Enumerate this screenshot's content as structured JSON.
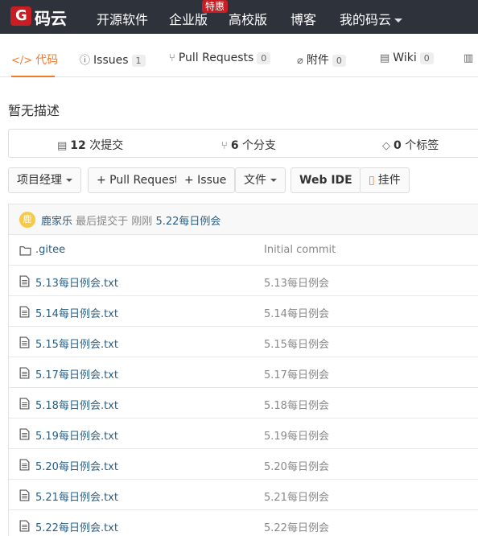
{
  "topnav": {
    "brand": "码云",
    "logo_letter": "G",
    "links": [
      "开源软件",
      "企业版",
      "高校版",
      "博客",
      "我的码云"
    ],
    "special_badge": "特惠"
  },
  "tabs": [
    {
      "label": "代码",
      "icon": "code-icon",
      "count": null
    },
    {
      "label": "Issues",
      "icon": "issues-icon",
      "count": "1"
    },
    {
      "label": "Pull Requests",
      "icon": "pull-request-icon",
      "count": "0"
    },
    {
      "label": "附件",
      "icon": "attachment-icon",
      "count": "0"
    },
    {
      "label": "Wiki",
      "icon": "wiki-icon",
      "count": "0"
    }
  ],
  "description": "暂无描述",
  "stats": {
    "commits_count": "12",
    "commits_label": "次提交",
    "branches_count": "6",
    "branches_label": "个分支",
    "tags_count": "0",
    "tags_label": "个标签"
  },
  "actions": {
    "manage": "项目经理",
    "pull_request": "+ Pull Request",
    "issue": "+ Issue",
    "file": "文件",
    "webide": "Web IDE",
    "attach": "挂件"
  },
  "commit": {
    "avatar_text": "鹿",
    "author": "鹿家乐",
    "text": "最后提交于 刚刚",
    "message": "5.22每日例会"
  },
  "files": [
    {
      "name": ".gitee",
      "type": "folder",
      "message": "Initial commit"
    },
    {
      "name": "5.13每日例会.txt",
      "type": "file",
      "message": "5.13每日例会"
    },
    {
      "name": "5.14每日例会.txt",
      "type": "file",
      "message": "5.14每日例会"
    },
    {
      "name": "5.15每日例会.txt",
      "type": "file",
      "message": "5.15每日例会"
    },
    {
      "name": "5.17每日例会.txt",
      "type": "file",
      "message": "5.17每日例会"
    },
    {
      "name": "5.18每日例会.txt",
      "type": "file",
      "message": "5.18每日例会"
    },
    {
      "name": "5.19每日例会.txt",
      "type": "file",
      "message": "5.19每日例会"
    },
    {
      "name": "5.20每日例会.txt",
      "type": "file",
      "message": "5.20每日例会"
    },
    {
      "name": "5.21每日例会.txt",
      "type": "file",
      "message": "5.21每日例会"
    },
    {
      "name": "5.22每日例会.txt",
      "type": "file",
      "message": "5.22每日例会"
    }
  ],
  "colors": {
    "nav_bg": "#2e323b",
    "brand_red": "#c71d23",
    "accent": "#f17b2c",
    "link": "#2a5f86"
  }
}
